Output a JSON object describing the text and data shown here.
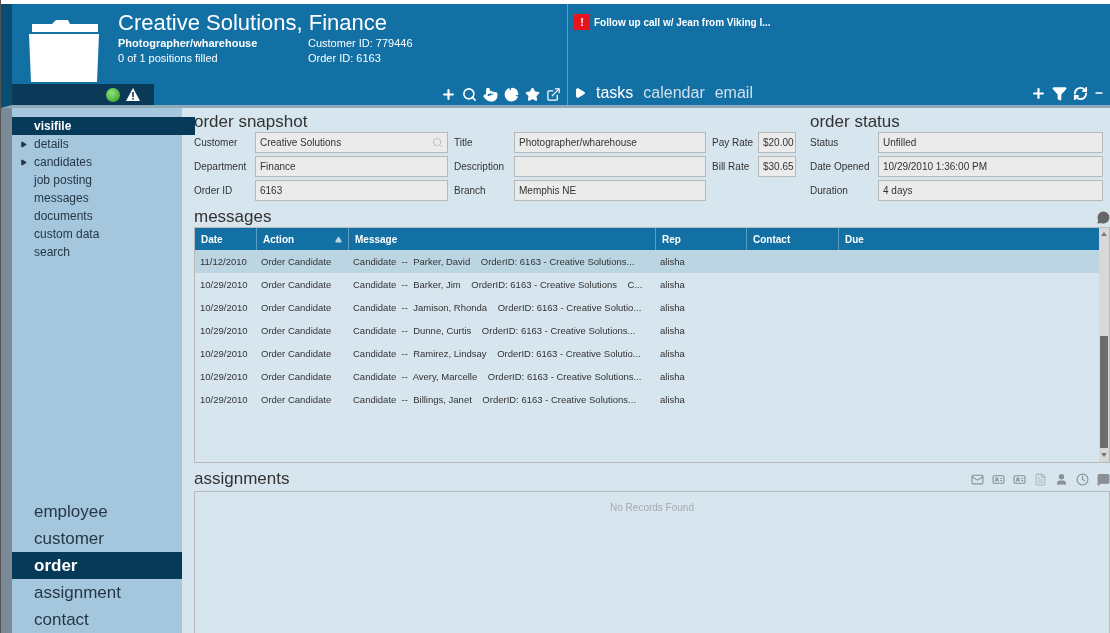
{
  "header": {
    "title": "Creative Solutions, Finance",
    "subtitle": "Photographer/wharehouse",
    "positions": "0 of 1 positions filled",
    "customer_id": "Customer ID: 779446",
    "order_id": "Order ID: 6163"
  },
  "alert": {
    "text": "Follow up call w/ Jean from Viking I...",
    "mark": "!"
  },
  "tabs": [
    {
      "label": "tasks",
      "selected": true
    },
    {
      "label": "calendar",
      "selected": false
    },
    {
      "label": "email",
      "selected": false
    }
  ],
  "sidebar": {
    "items": [
      {
        "label": "visifile",
        "kind": "link",
        "selected": true
      },
      {
        "label": "details",
        "kind": "folder",
        "selected": false
      },
      {
        "label": "candidates",
        "kind": "folder",
        "selected": false
      },
      {
        "label": "job posting",
        "kind": "link",
        "selected": false
      },
      {
        "label": "messages",
        "kind": "link",
        "selected": false
      },
      {
        "label": "documents",
        "kind": "link",
        "selected": false
      },
      {
        "label": "custom data",
        "kind": "link",
        "selected": false
      },
      {
        "label": "search",
        "kind": "link",
        "selected": false
      }
    ]
  },
  "modules": [
    {
      "label": "employee",
      "selected": false
    },
    {
      "label": "customer",
      "selected": false
    },
    {
      "label": "order",
      "selected": true
    },
    {
      "label": "assignment",
      "selected": false
    },
    {
      "label": "contact",
      "selected": false
    }
  ],
  "order_snapshot": {
    "title": "order snapshot",
    "groups": [
      [
        {
          "label": "Customer",
          "value": "Creative Solutions",
          "kind": "search"
        },
        {
          "label": "Department",
          "value": "Finance",
          "kind": "text"
        },
        {
          "label": "Order ID",
          "value": "6163",
          "kind": "text"
        }
      ],
      [
        {
          "label": "Title",
          "value": "Photographer/wharehouse",
          "kind": "text"
        },
        {
          "label": "Description",
          "kind": "text"
        },
        {
          "label": "Branch",
          "value": "Memphis NE",
          "kind": "text"
        }
      ],
      [
        {
          "label": "Pay Rate",
          "value": "$20.00",
          "kind": "text"
        },
        {
          "label": "Bill Rate",
          "value": "$30.65",
          "kind": "text"
        }
      ]
    ]
  },
  "order_status": {
    "title": "order status",
    "fields": [
      {
        "label": "Status",
        "value": "Unfilled"
      },
      {
        "label": "Date Opened",
        "value": "10/29/2010 1:36:00 PM"
      },
      {
        "label": "Duration",
        "value": "4 days"
      }
    ]
  },
  "messages": {
    "title": "messages",
    "columns": [
      "Date",
      "Action",
      "Message",
      "Rep",
      "Contact",
      "Due"
    ],
    "rows": [
      {
        "date": "11/12/2010",
        "action": "Order Candidate",
        "message": "Candidate  --  Parker, David    OrderID: 6163 - Creative Solutions...",
        "rep": "alisha",
        "selected": true
      },
      {
        "date": "10/29/2010",
        "action": "Order Candidate",
        "message": "Candidate  --  Barker, Jim    OrderID: 6163 - Creative Solutions    C...",
        "rep": "alisha",
        "selected": false
      },
      {
        "date": "10/29/2010",
        "action": "Order Candidate",
        "message": "Candidate  --  Jamison, Rhonda    OrderID: 6163 - Creative Solutio...",
        "rep": "alisha",
        "selected": false
      },
      {
        "date": "10/29/2010",
        "action": "Order Candidate",
        "message": "Candidate  --  Dunne, Curtis    OrderID: 6163 - Creative Solutions...",
        "rep": "alisha",
        "selected": false
      },
      {
        "date": "10/29/2010",
        "action": "Order Candidate",
        "message": "Candidate  --  Ramirez, Lindsay    OrderID: 6163 - Creative Solutio...",
        "rep": "alisha",
        "selected": false
      },
      {
        "date": "10/29/2010",
        "action": "Order Candidate",
        "message": "Candidate  --  Avery, Marcelle    OrderID: 6163 - Creative Solutions...",
        "rep": "alisha",
        "selected": false
      },
      {
        "date": "10/29/2010",
        "action": "Order Candidate",
        "message": "Candidate  --  Billings, Janet    OrderID: 6163 - Creative Solutions...",
        "rep": "alisha",
        "selected": false
      }
    ]
  },
  "assignments": {
    "title": "assignments",
    "empty_text": "No Records Found"
  }
}
